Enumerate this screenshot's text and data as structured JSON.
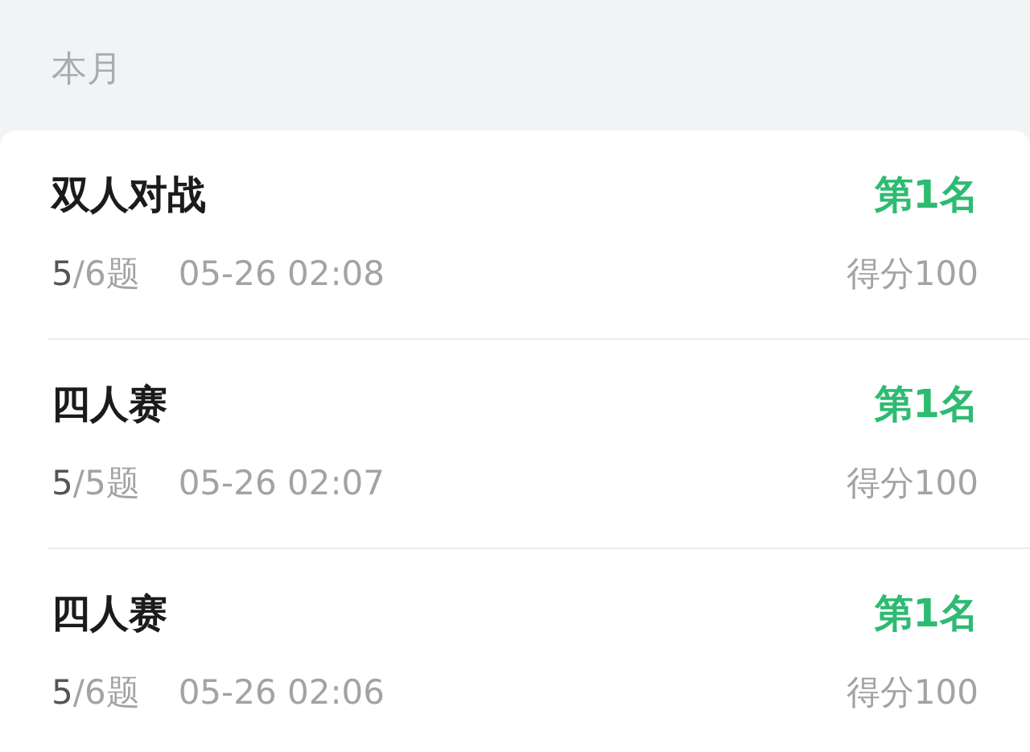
{
  "section_title": "本月",
  "records": [
    {
      "title": "双人对战",
      "rank": "第1名",
      "correct": "5",
      "total": "/6题",
      "time": "05-26 02:08",
      "score": "得分100"
    },
    {
      "title": "四人赛",
      "rank": "第1名",
      "correct": "5",
      "total": "/5题",
      "time": "05-26 02:07",
      "score": "得分100"
    },
    {
      "title": "四人赛",
      "rank": "第1名",
      "correct": "5",
      "total": "/6题",
      "time": "05-26 02:06",
      "score": "得分100"
    }
  ]
}
